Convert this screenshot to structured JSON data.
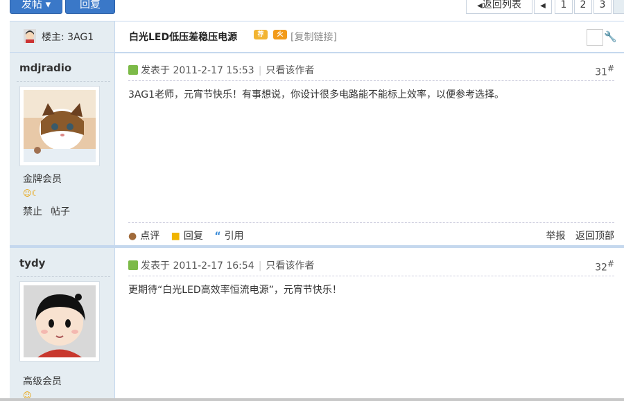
{
  "toolbar": {
    "new_thread": "发帖",
    "reply": "回复"
  },
  "pager": {
    "back": "返回列表",
    "pages": [
      "1",
      "2",
      "3"
    ]
  },
  "thread": {
    "louzhu_label": "楼主: 3AG1",
    "title": "白光LED低压差稳压电源",
    "copy_link": "[复制链接]"
  },
  "posts": [
    {
      "username": "mdjradio",
      "rank": "金牌会员",
      "ops": [
        "禁止",
        "帖子"
      ],
      "posted": "发表于 2011-2-17 15:53",
      "only_author": "只看该作者",
      "floor": "31",
      "content": "3AG1老师，元宵节快乐！有事想说，你设计很多电路能不能标上效率，以便参考选择。",
      "actions": [
        "点评",
        "回复",
        "引用"
      ],
      "right_actions": [
        "举报",
        "返回顶部"
      ]
    },
    {
      "username": "tydy",
      "rank": "高级会员",
      "posted": "发表于 2011-2-17 16:54",
      "only_author": "只看该作者",
      "floor": "32",
      "content": "更期待“白光LED高效率恒流电源”，元宵节快乐！"
    }
  ]
}
